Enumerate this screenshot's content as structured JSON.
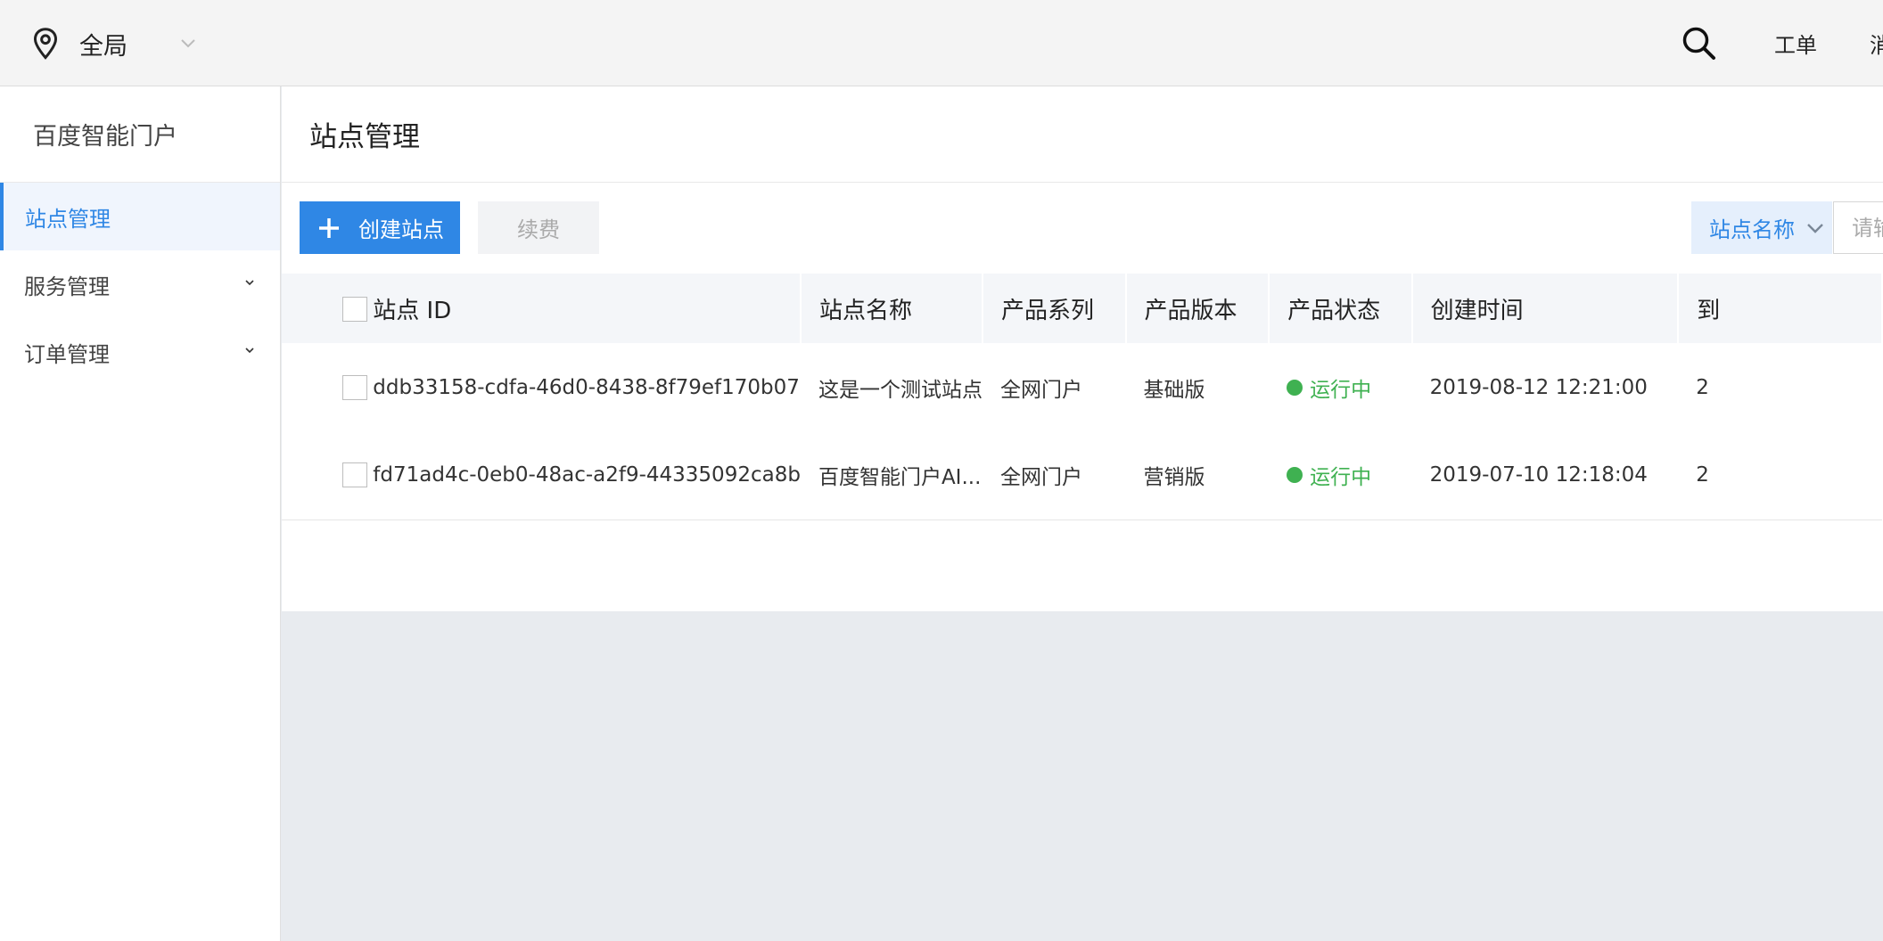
{
  "header": {
    "region_label": "全局",
    "ticket_link": "工单",
    "message_link": "消"
  },
  "sidebar": {
    "brand": "百度智能门户",
    "items": [
      {
        "label": "站点管理",
        "active": true
      },
      {
        "label": "服务管理",
        "active": false
      },
      {
        "label": "订单管理",
        "active": false
      }
    ]
  },
  "main": {
    "title": "站点管理",
    "create_button": "创建站点",
    "renew_button": "续费",
    "filter_field": "站点名称",
    "filter_placeholder": "请输"
  },
  "table": {
    "columns": [
      "站点 ID",
      "站点名称",
      "产品系列",
      "产品版本",
      "产品状态",
      "创建时间",
      "到"
    ],
    "rows": [
      {
        "id": "ddb33158-cdfa-46d0-8438-8f79ef170b07",
        "name": "这是一个测试站点",
        "series": "全网门户",
        "version": "基础版",
        "status": "运行中",
        "created": "2019-08-12 12:21:00",
        "expire": "2"
      },
      {
        "id": "fd71ad4c-0eb0-48ac-a2f9-44335092ca8b",
        "name": "百度智能门户AI...",
        "series": "全网门户",
        "version": "营销版",
        "status": "运行中",
        "created": "2019-07-10 12:18:04",
        "expire": "2"
      }
    ]
  },
  "colors": {
    "primary": "#2f87e5",
    "status_running": "#3fb151",
    "page_background": "#e8ebef"
  },
  "icons": {
    "region": "location-pin-icon",
    "search": "search-icon",
    "add": "plus-icon",
    "dropdown": "chevron-down-icon"
  }
}
